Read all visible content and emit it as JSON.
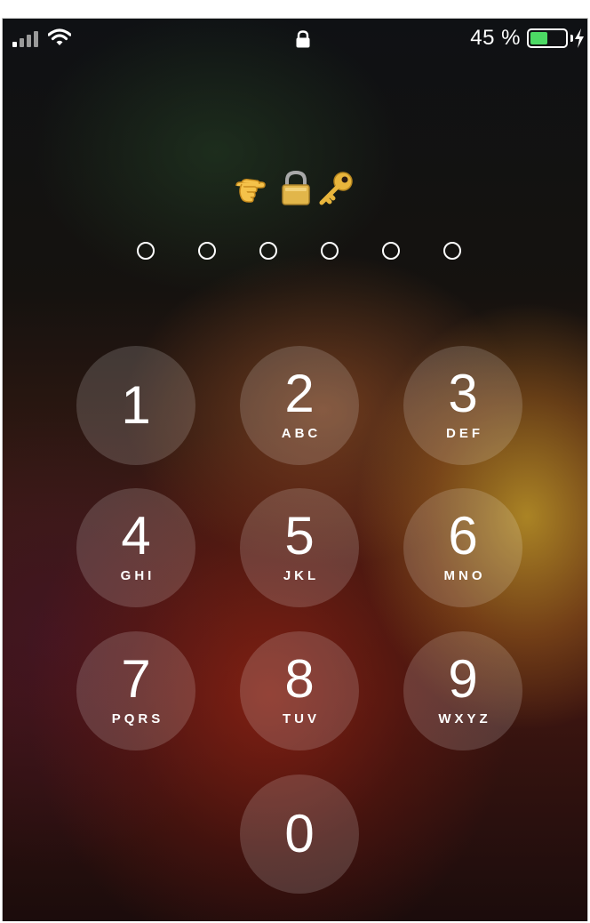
{
  "status_bar": {
    "battery_percent": "45 %",
    "battery_level": 0.45,
    "battery_fill_color": "#4cd964",
    "signal_icon": "cellular-signal-icon",
    "wifi_icon": "wifi-icon",
    "lock_icon": "lock-icon",
    "charging_icon": "bolt-icon"
  },
  "title": {
    "emoji": [
      "pointing-hand-icon",
      "locked-padlock-icon",
      "key-icon"
    ]
  },
  "passcode": {
    "length": 6,
    "filled": 0
  },
  "keypad": {
    "keys": [
      {
        "digit": "1",
        "letters": ""
      },
      {
        "digit": "2",
        "letters": "ABC"
      },
      {
        "digit": "3",
        "letters": "DEF"
      },
      {
        "digit": "4",
        "letters": "GHI"
      },
      {
        "digit": "5",
        "letters": "JKL"
      },
      {
        "digit": "6",
        "letters": "MNO"
      },
      {
        "digit": "7",
        "letters": "PQRS"
      },
      {
        "digit": "8",
        "letters": "TUV"
      },
      {
        "digit": "9",
        "letters": "WXYZ"
      },
      {
        "digit": "0",
        "letters": ""
      }
    ]
  }
}
